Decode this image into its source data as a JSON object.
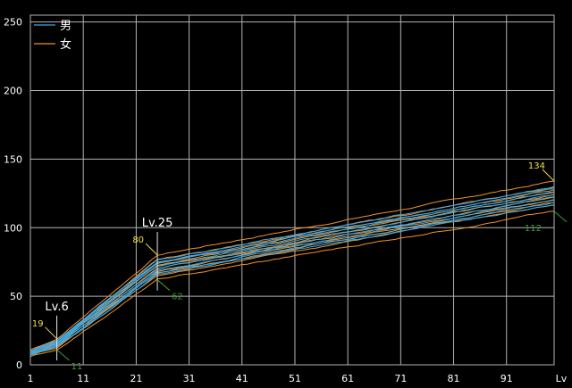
{
  "chart_data": {
    "type": "line",
    "title": "",
    "xlabel": "Lv",
    "ylabel": "",
    "xlim": [
      1,
      100
    ],
    "ylim": [
      0,
      255
    ],
    "x_ticks": [
      "1",
      "11",
      "21",
      "31",
      "41",
      "51",
      "61",
      "71",
      "81",
      "91"
    ],
    "y_ticks": [
      "0",
      "50",
      "100",
      "150",
      "200",
      "250"
    ],
    "grid": true,
    "legend": {
      "position": "top-left",
      "entries": [
        {
          "name": "男",
          "color": "#3aa9e8"
        },
        {
          "name": "女",
          "color": "#f0902a"
        }
      ]
    },
    "colors": {
      "male": "#3aa9e8",
      "female": "#f0902a",
      "grid": "#b4b4b4",
      "max_label": "#f0e040",
      "min_label": "#3a9a3a"
    },
    "band": {
      "x": [
        1,
        6,
        25,
        100
      ],
      "low": [
        6,
        11,
        62,
        112
      ],
      "high": [
        11,
        19,
        80,
        134
      ]
    },
    "annotations": [
      {
        "x": 6,
        "label": "Lv.6",
        "max": "19",
        "min": "11"
      },
      {
        "x": 25,
        "label": "Lv.25",
        "max": "80",
        "min": "62"
      },
      {
        "x": 100,
        "label": "",
        "max": "134",
        "min": "112"
      }
    ],
    "series_count": {
      "male": 8,
      "female": 10
    }
  }
}
